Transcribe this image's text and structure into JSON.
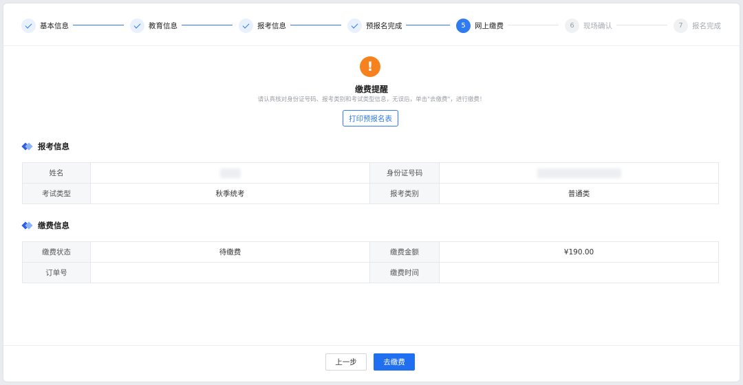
{
  "steps": [
    {
      "label": "基本信息",
      "state": "done"
    },
    {
      "label": "教育信息",
      "state": "done"
    },
    {
      "label": "报考信息",
      "state": "done"
    },
    {
      "label": "预报名完成",
      "state": "done"
    },
    {
      "label": "网上缴费",
      "state": "active",
      "number": "5"
    },
    {
      "label": "现场确认",
      "state": "todo",
      "number": "6"
    },
    {
      "label": "报名完成",
      "state": "todo",
      "number": "7"
    }
  ],
  "notice": {
    "icon": "exclamation-icon",
    "icon_glyph": "!",
    "title": "缴费提醒",
    "description": "请认真核对身份证号码、报考类别和考试类型信息，无误后，单击\"去缴费\"，进行缴费！",
    "print_button": "打印预报名表"
  },
  "registration": {
    "title": "报考信息",
    "name_label": "姓名",
    "name_value": "",
    "id_label": "身份证号码",
    "id_value": "",
    "exam_type_label": "考试类型",
    "exam_type_value": "秋季统考",
    "category_label": "报考类别",
    "category_value": "普通类"
  },
  "payment": {
    "title": "缴费信息",
    "status_label": "缴费状态",
    "status_value": "待缴费",
    "amount_label": "缴费金额",
    "amount_value": "¥190.00",
    "order_label": "订单号",
    "order_value": "",
    "time_label": "缴费时间",
    "time_value": ""
  },
  "footer": {
    "prev_button": "上一步",
    "pay_button": "去缴费"
  },
  "colors": {
    "primary": "#2f7bef",
    "warning": "#f5821f"
  }
}
